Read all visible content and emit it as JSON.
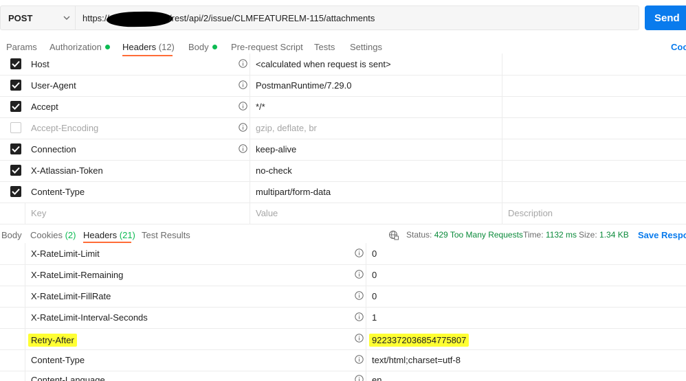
{
  "request": {
    "method": "POST",
    "url_prefix": "https://",
    "url_suffix": "/rest/api/2/issue/CLMFEATURELM-115/attachments",
    "send_label": "Send"
  },
  "request_tabs": {
    "params": "Params",
    "authorization": "Authorization",
    "headers": "Headers",
    "headers_count": "(12)",
    "body": "Body",
    "pre_request": "Pre-request Script",
    "tests": "Tests",
    "settings": "Settings",
    "cookies": "Coo"
  },
  "request_headers": [
    {
      "key": "Host",
      "value": "<calculated when request is sent>"
    },
    {
      "key": "User-Agent",
      "value": "PostmanRuntime/7.29.0"
    },
    {
      "key": "Accept",
      "value": "*/*"
    },
    {
      "key": "Accept-Encoding",
      "value": "gzip, deflate, br"
    },
    {
      "key": "Connection",
      "value": "keep-alive"
    },
    {
      "key": "X-Atlassian-Token",
      "value": "no-check"
    },
    {
      "key": "Content-Type",
      "value": "multipart/form-data"
    }
  ],
  "new_row": {
    "key_placeholder": "Key",
    "value_placeholder": "Value",
    "description_placeholder": "Description"
  },
  "response_tabs": {
    "body": "Body",
    "cookies": "Cookies",
    "cookies_count": "(2)",
    "headers": "Headers",
    "headers_count": "(21)",
    "test_results": "Test Results"
  },
  "response_status": {
    "status_label": "Status:",
    "status_value": "429 Too Many Requests",
    "time_label": "Time:",
    "time_value": "1132 ms",
    "size_label": "Size:",
    "size_value": "1.34 KB",
    "save_label": "Save Respon"
  },
  "response_headers": [
    {
      "key": "X-RateLimit-Limit",
      "value": "0"
    },
    {
      "key": "X-RateLimit-Remaining",
      "value": "0"
    },
    {
      "key": "X-RateLimit-FillRate",
      "value": "0"
    },
    {
      "key": "X-RateLimit-Interval-Seconds",
      "value": "1"
    },
    {
      "key": "Retry-After",
      "value": "9223372036854775807"
    },
    {
      "key": "Content-Type",
      "value": "text/html;charset=utf-8"
    },
    {
      "key": "Content-Language",
      "value": "en"
    }
  ],
  "colors": {
    "accent": "#097bed",
    "tab_underline": "#ff6c37",
    "ok_dot": "#0cbb52",
    "highlight": "#ffff33"
  }
}
